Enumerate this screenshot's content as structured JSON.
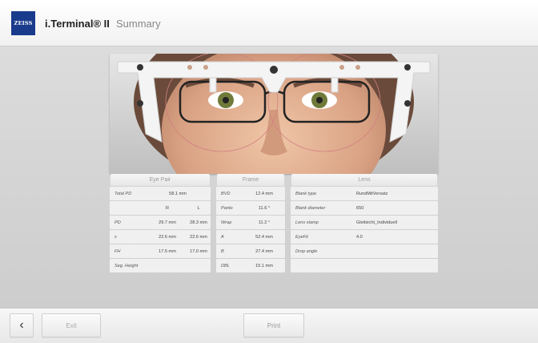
{
  "header": {
    "logo": "ZEISS",
    "title": "i.Terminal® II",
    "subtitle": "Summary"
  },
  "eye_pair": {
    "heading": "Eye Pair",
    "total_pd": {
      "label": "Total PD",
      "value": "58.1 mm"
    },
    "sides": {
      "right": "R",
      "left": "L"
    },
    "rows": [
      {
        "label": "PD",
        "r": "29.7 mm",
        "l": "28.3 mm"
      },
      {
        "label": "x",
        "r": "22.6 mm",
        "l": "22.6 mm"
      },
      {
        "label": "FH",
        "r": "17.5 mm",
        "l": "17.0 mm"
      }
    ],
    "seg_height": {
      "label": "Seg. Height",
      "value": ""
    }
  },
  "frame": {
    "heading": "Frame",
    "rows": [
      {
        "label": "BVD",
        "value": "12.4 mm"
      },
      {
        "label": "Panto",
        "value": "11.6 °"
      },
      {
        "label": "Wrap",
        "value": "11.2 °"
      },
      {
        "label": "A",
        "value": "52.4 mm"
      },
      {
        "label": "B",
        "value": "27.4 mm"
      },
      {
        "label": "DBL",
        "value": "15.1 mm"
      }
    ]
  },
  "lens": {
    "heading": "Lens",
    "rows": [
      {
        "label": "Blank type",
        "value": "RundMitVersatz"
      },
      {
        "label": "Blank diameter",
        "value": "650"
      },
      {
        "label": "Lens stamp",
        "value": "Gleitsicht_Individuell"
      },
      {
        "label": "EyeFit",
        "value": "4.0"
      },
      {
        "label": "Drop angle",
        "value": ""
      },
      {
        "label": "",
        "value": ""
      }
    ]
  },
  "footer": {
    "back_icon": "chevron-left-icon",
    "back": "‹",
    "exit": "Exit",
    "print": "Print"
  },
  "colors": {
    "brand": "#1a3a8c",
    "background": "#d6d6d6"
  }
}
